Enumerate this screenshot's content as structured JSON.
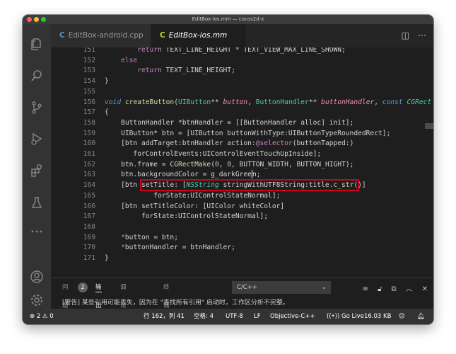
{
  "window": {
    "title": "EditBox-ios.mm — cocos2d-x"
  },
  "tabs": [
    {
      "label": "EditBox-android.cpp",
      "icon": "cpp-file-icon",
      "active": false
    },
    {
      "label": "EditBox-ios.mm",
      "icon": "objc-file-icon",
      "active": true
    }
  ],
  "editor": {
    "lines": [
      {
        "num": "151",
        "text": "        return TEXT_LINE_HEIGHT * TEXT_VIEW_MAX_LINE_SHOWN;"
      },
      {
        "num": "152",
        "text": "    else"
      },
      {
        "num": "153",
        "text": "        return TEXT_LINE_HEIGHT;"
      },
      {
        "num": "154",
        "text": "}"
      },
      {
        "num": "155",
        "text": ""
      },
      {
        "num": "156",
        "text": "void createButton(UIButton** button, ButtonHandler** buttonHandler, const CGRect"
      },
      {
        "num": "157",
        "text": "{"
      },
      {
        "num": "158",
        "text": "    ButtonHandler *btnHandler = [[ButtonHandler alloc] init];"
      },
      {
        "num": "159",
        "text": "    UIButton* btn = [UIButton buttonWithType:UIButtonTypeRoundedRect];"
      },
      {
        "num": "160",
        "text": "    [btn addTarget:btnHandler action:@selector(buttonTapped:)"
      },
      {
        "num": "161",
        "text": "       forControlEvents:UIControlEventTouchUpInside];"
      },
      {
        "num": "162",
        "text": "    btn.frame = CGRectMake(0, 0, BUTTON_WIDTH, BUTTON_HIGHT);"
      },
      {
        "num": "163",
        "text": "    btn.backgroundColor = g_darkGreen;"
      },
      {
        "num": "164",
        "text": "    [btn setTitle: [NSString stringWithUTF8String:title.c_str()]"
      },
      {
        "num": "165",
        "text": "            forState:UIControlStateNormal];"
      },
      {
        "num": "166",
        "text": "    [btn setTitleColor: [UIColor whiteColor]"
      },
      {
        "num": "167",
        "text": "         forState:UIControlStateNormal];"
      },
      {
        "num": "168",
        "text": ""
      },
      {
        "num": "169",
        "text": "    *button = btn;"
      },
      {
        "num": "170",
        "text": "    *buttonHandler = btnHandler;"
      },
      {
        "num": "171",
        "text": "}"
      }
    ]
  },
  "panel": {
    "tabs": [
      {
        "label": "问题",
        "active": false
      },
      {
        "label": "输出",
        "active": true
      },
      {
        "label": "调试控制台",
        "active": false
      },
      {
        "label": "终端",
        "active": false
      }
    ],
    "problems_count": "2",
    "output_channel": "C/C++",
    "output_text": "[警告] 某些引用可能丢失，因为在 \"查找所有引用\" 启动时，工作区分析不完整。"
  },
  "statusbar": {
    "problems": "⊗ 2 ⚠ 0",
    "position": "行 162，列 41",
    "indent": "空格: 4",
    "encoding": "UTF-8",
    "eol": "LF",
    "language": "Objective-C++",
    "golive": "Go Live",
    "filesize": "16.03 KB"
  },
  "colors": {
    "highlight_border": "#d0021b",
    "editor_bg": "#1e1e1e",
    "statusbar_bg": "#333333"
  }
}
